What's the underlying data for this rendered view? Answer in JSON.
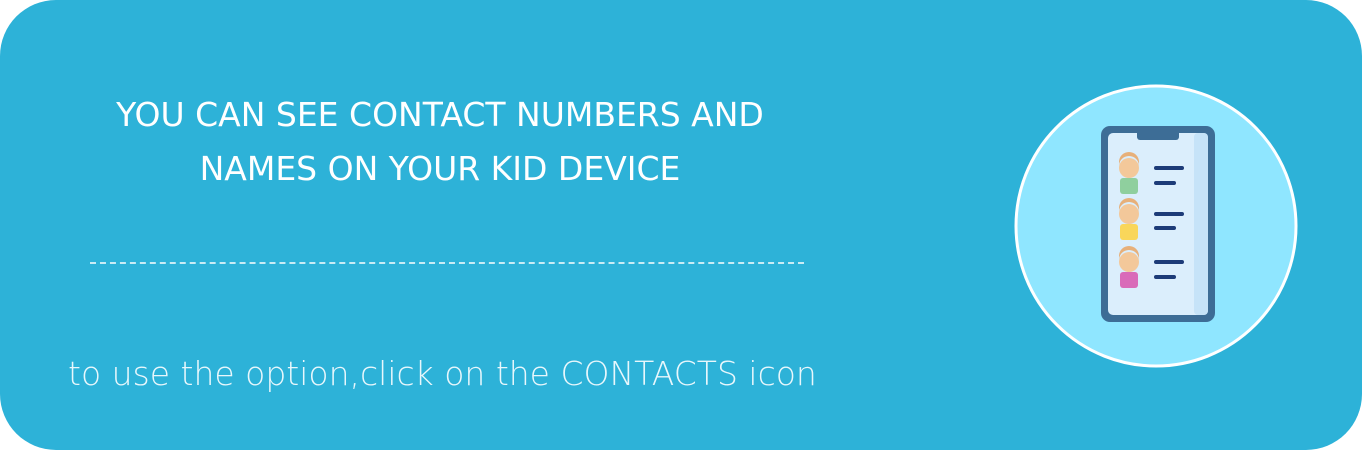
{
  "headline": {
    "line1": "YOU CAN SEE CONTACT NUMBERS AND",
    "line2": "NAMES ON YOUR KID DEVICE"
  },
  "instruction": "to use the option,click on the CONTACTS icon",
  "icon": {
    "name": "contacts-phone-icon",
    "circle_color": "#8fe6ff",
    "phone_frame_color": "#3d6d96",
    "screen_color": "#dbeefc",
    "line_color": "#1c3b78",
    "avatar_shirt_colors": [
      "#8fcf9e",
      "#f9d65a",
      "#d96bb9"
    ]
  },
  "colors": {
    "background": "#2db2d8",
    "text": "#ffffff"
  }
}
